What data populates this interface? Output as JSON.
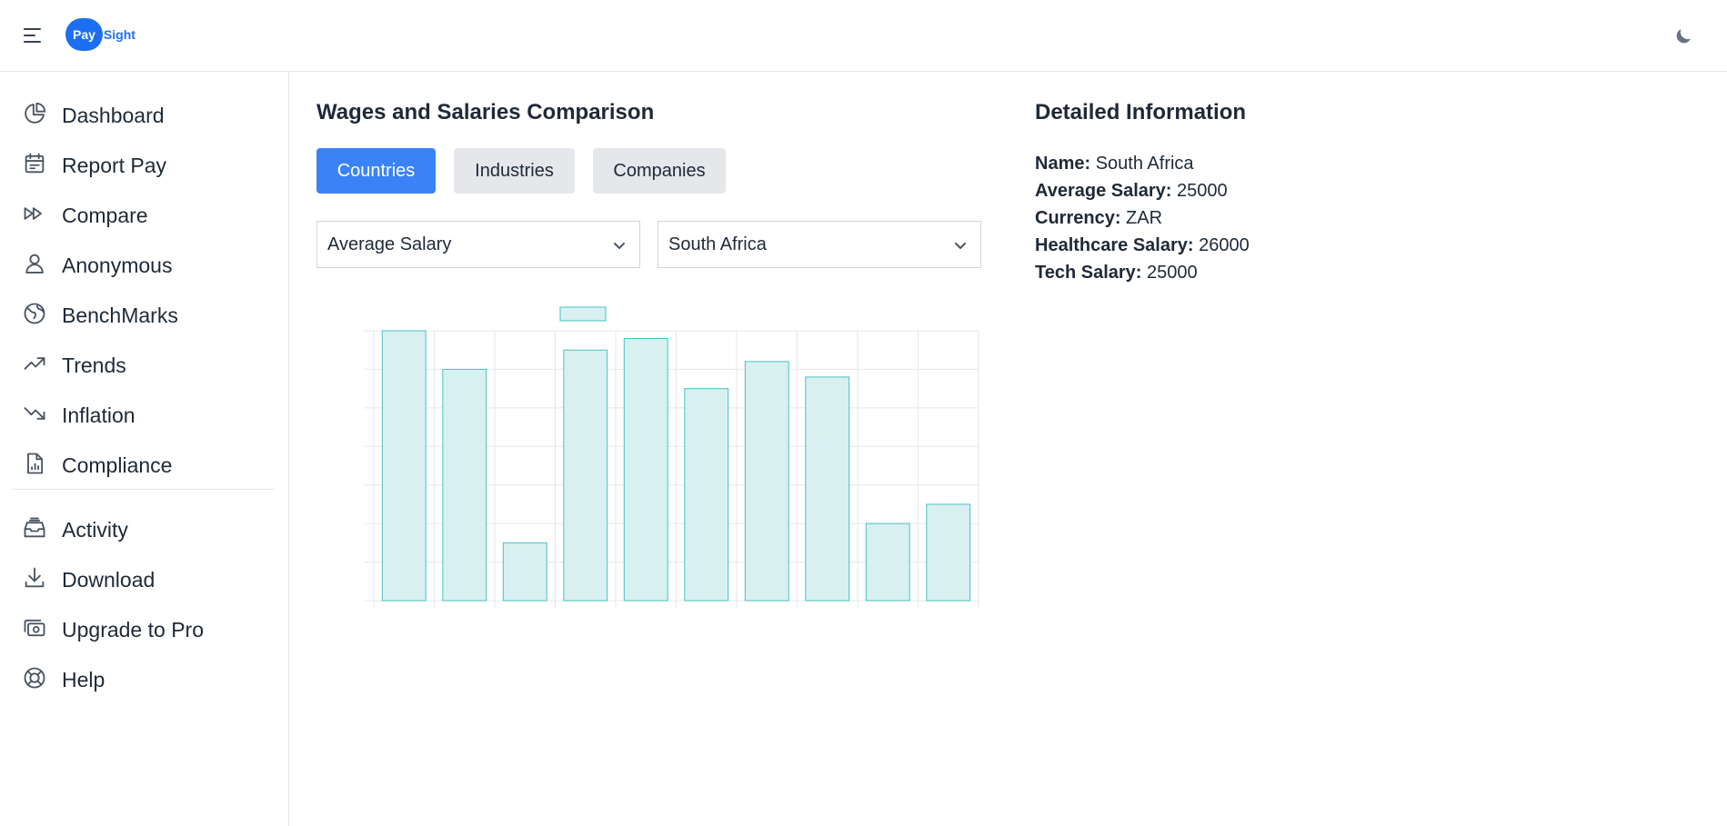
{
  "header": {
    "logo_pill": "Pay",
    "logo_text": "Sight",
    "menu_icon": "hamburger-menu-icon",
    "theme_icon": "moon-icon"
  },
  "sidebar": {
    "items": [
      {
        "label": "Dashboard",
        "icon": "pie-chart-icon"
      },
      {
        "label": "Report Pay",
        "icon": "calendar-icon"
      },
      {
        "label": "Compare",
        "icon": "fast-forward-icon"
      },
      {
        "label": "Anonymous",
        "icon": "user-icon"
      },
      {
        "label": "BenchMarks",
        "icon": "globe-icon"
      },
      {
        "label": "Trends",
        "icon": "trending-up-icon"
      },
      {
        "label": "Inflation",
        "icon": "trending-down-icon"
      },
      {
        "label": "Compliance",
        "icon": "document-chart-icon"
      }
    ],
    "bottom_items": [
      {
        "label": "Activity",
        "icon": "inbox-stack-icon"
      },
      {
        "label": "Download",
        "icon": "download-icon"
      },
      {
        "label": "Upgrade to Pro",
        "icon": "cash-icon"
      },
      {
        "label": "Help",
        "icon": "lifebuoy-icon"
      }
    ]
  },
  "comparison": {
    "title": "Wages and Salaries Comparison",
    "tabs": [
      "Countries",
      "Industries",
      "Companies"
    ],
    "active_tab": "Countries",
    "metric_select": "Average Salary",
    "country_select": "South Africa"
  },
  "chart_data": {
    "type": "bar",
    "categories": [
      "",
      "",
      "",
      "",
      "",
      "",
      "",
      "",
      "",
      ""
    ],
    "values": [
      7.0,
      6.0,
      1.5,
      6.5,
      6.8,
      5.5,
      6.2,
      5.8,
      2.0,
      2.5
    ],
    "ylim": [
      0,
      7
    ],
    "grid": true,
    "legend": "top",
    "bar_fill": "#d9f0f1",
    "bar_stroke": "#4bc0c0"
  },
  "details": {
    "title": "Detailed Information",
    "rows": [
      {
        "key": "Name:",
        "value": "South Africa"
      },
      {
        "key": "Average Salary:",
        "value": "25000"
      },
      {
        "key": "Currency:",
        "value": "ZAR"
      },
      {
        "key": "Healthcare Salary:",
        "value": "26000"
      },
      {
        "key": "Tech Salary:",
        "value": "25000"
      }
    ]
  },
  "colors": {
    "primary": "#3b82f6",
    "brand": "#1d6ff2",
    "border": "#e5e7eb"
  }
}
